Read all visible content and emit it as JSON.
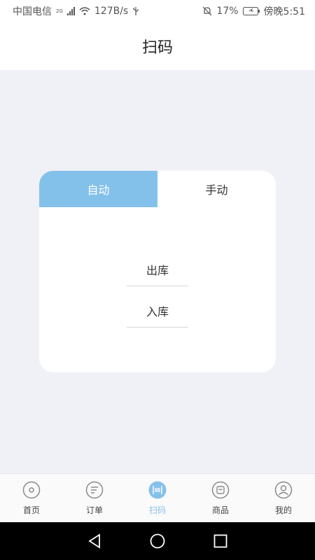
{
  "status_bar": {
    "carrier": "中国电信",
    "network": "2G",
    "speed": "127B/s",
    "battery": "17%",
    "time": "傍晚5:51"
  },
  "header": {
    "title": "扫码"
  },
  "mode_tabs": [
    {
      "label": "自动",
      "active": true
    },
    {
      "label": "手动",
      "active": false
    }
  ],
  "actions": {
    "outbound": "出库",
    "inbound": "入库"
  },
  "tabbar": [
    {
      "label": "首页",
      "icon": "home-disc-icon"
    },
    {
      "label": "订单",
      "icon": "order-list-icon"
    },
    {
      "label": "扫码",
      "icon": "scan-icon",
      "active": true
    },
    {
      "label": "商品",
      "icon": "goods-icon"
    },
    {
      "label": "我的",
      "icon": "user-icon"
    }
  ],
  "colors": {
    "accent": "#84c1ea",
    "icon_gray": "#8a8a8a",
    "page_bg": "#f0f1f7"
  }
}
